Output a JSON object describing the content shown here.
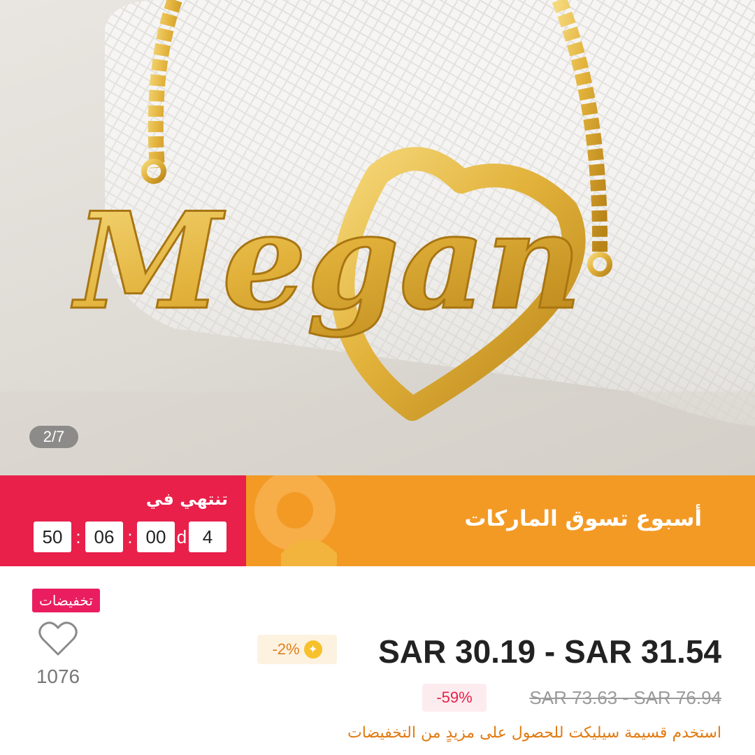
{
  "gallery": {
    "image_counter": "2/7",
    "pendant_text": "Megan"
  },
  "promo_banner": {
    "title": "أسبوع تسوق الماركات",
    "countdown_label": "تنتهي في",
    "countdown": {
      "days": "4",
      "days_unit": "d",
      "hours": "00",
      "minutes": "06",
      "seconds": "50",
      "separator": ":"
    },
    "colors": {
      "banner": "#f39a25",
      "countdown_bg": "#e8204a"
    }
  },
  "product": {
    "sale_tag": "تخفيضات",
    "wishlist_count": "1076",
    "price_range": "SAR 30.19 - SAR 31.54",
    "coupon_discount": "-2%",
    "original_price_range": "SAR 73.63 - SAR 76.94",
    "discount_percent": "-59%",
    "installment_note": "استخدم قسيمة سيليكت للحصول على مزيدٍ من التخفيضات"
  },
  "icons": [
    "heart-outline-icon",
    "coupon-star-icon"
  ]
}
